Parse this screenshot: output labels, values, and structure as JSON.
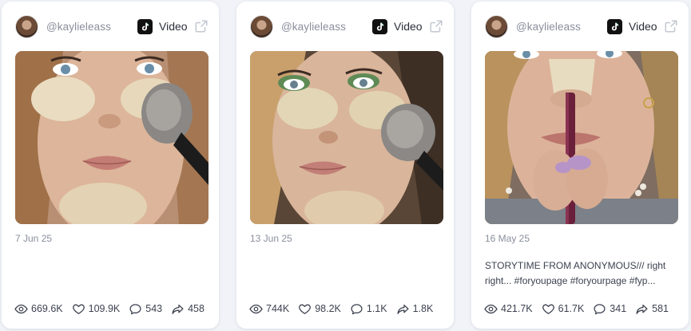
{
  "colors": {
    "card_bg": "#ffffff",
    "page_bg": "#f1f3f8",
    "muted_text": "#8a8f9c",
    "body_text": "#3d4250"
  },
  "posts": [
    {
      "handle": "@kaylieleass",
      "platform_icon": "tiktok-icon",
      "type": "Video",
      "date": "7 Jun 25",
      "caption": "",
      "stats": {
        "views": "669.6K",
        "likes": "109.9K",
        "comments": "543",
        "shares": "458"
      }
    },
    {
      "handle": "@kaylieleass",
      "platform_icon": "tiktok-icon",
      "type": "Video",
      "date": "13 Jun 25",
      "caption": "",
      "stats": {
        "views": "744K",
        "likes": "98.2K",
        "comments": "1.1K",
        "shares": "1.8K"
      }
    },
    {
      "handle": "@kaylieleass",
      "platform_icon": "tiktok-icon",
      "type": "Video",
      "date": "16 May 25",
      "caption": "STORYTIME FROM ANONYMOUS/// right right... #foryoupage #foryourpage #fyp...",
      "stats": {
        "views": "421.7K",
        "likes": "61.7K",
        "comments": "341",
        "shares": "581"
      }
    }
  ]
}
